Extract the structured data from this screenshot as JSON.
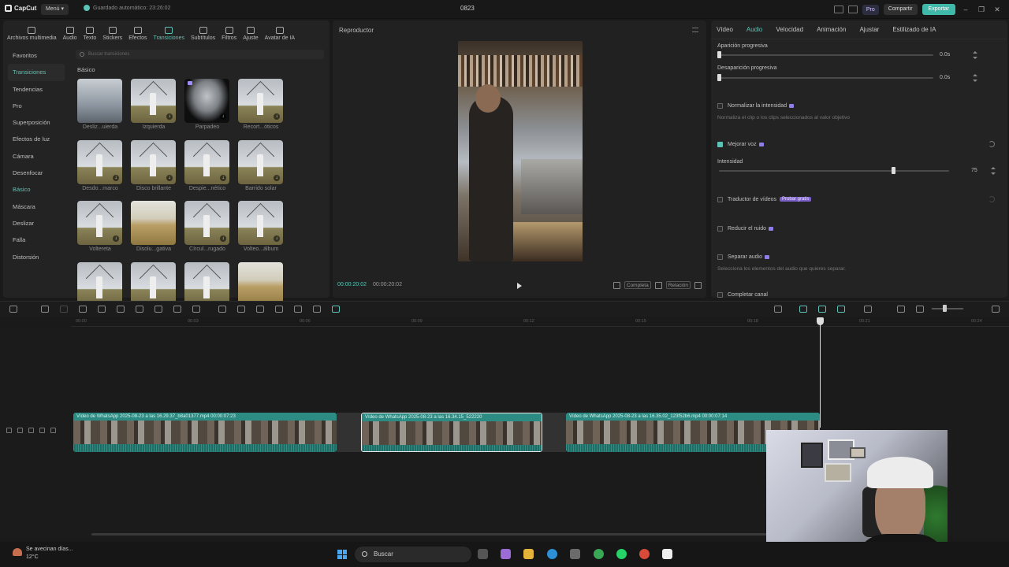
{
  "titlebar": {
    "app_name": "CapCut",
    "menu_label": "Menú",
    "autosave": "Guardado automático: 23:26:02",
    "project_name": "0823",
    "pro_label": "Pro",
    "share_label": "Compartir",
    "export_label": "Exportar"
  },
  "tools": [
    {
      "label": "Archivos multimedia",
      "icon": "media-icon"
    },
    {
      "label": "Audio",
      "icon": "audio-icon"
    },
    {
      "label": "Texto",
      "icon": "text-icon"
    },
    {
      "label": "Stickers",
      "icon": "sticker-icon"
    },
    {
      "label": "Efectos",
      "icon": "effects-icon"
    },
    {
      "label": "Transiciones",
      "icon": "transitions-icon",
      "active": true
    },
    {
      "label": "Subtítulos",
      "icon": "subtitles-icon"
    },
    {
      "label": "Filtros",
      "icon": "filters-icon"
    },
    {
      "label": "Ajuste",
      "icon": "adjust-icon"
    },
    {
      "label": "Avatar de IA",
      "icon": "ai-avatar-icon"
    }
  ],
  "categories": [
    "Favoritos",
    "Transiciones",
    "Tendencias",
    "Pro",
    "Superposición",
    "Efectos de luz",
    "Cámara",
    "Desenfocar",
    "Básico",
    "Máscara",
    "Deslizar",
    "Falla",
    "Distorsión"
  ],
  "search_placeholder": "Buscar transiciones",
  "section_label": "Básico",
  "transitions": [
    {
      "label": "Desliz...uierda",
      "thumb": "city",
      "download": false,
      "badge": false
    },
    {
      "label": "Izquierda",
      "thumb": "mill",
      "download": true,
      "badge": false
    },
    {
      "label": "Parpadeo",
      "thumb": "dark",
      "download": true,
      "badge": true
    },
    {
      "label": "Recort...óticos",
      "thumb": "mill",
      "download": true,
      "badge": false
    },
    {
      "label": "Desdo...marco",
      "thumb": "mill",
      "download": true,
      "badge": false
    },
    {
      "label": "Disco brillante",
      "thumb": "mill",
      "download": true,
      "badge": false
    },
    {
      "label": "Despie...nético",
      "thumb": "mill",
      "download": true,
      "badge": false
    },
    {
      "label": "Barrido solar",
      "thumb": "mill",
      "download": true,
      "badge": false
    },
    {
      "label": "Voltereta",
      "thumb": "mill",
      "download": true,
      "badge": false
    },
    {
      "label": "Disolu...gativa",
      "thumb": "field",
      "download": false,
      "badge": false
    },
    {
      "label": "Círcul...rugado",
      "thumb": "mill",
      "download": true,
      "badge": false
    },
    {
      "label": "Volteo...álbum",
      "thumb": "mill",
      "download": true,
      "badge": false
    },
    {
      "label": "",
      "thumb": "mill",
      "download": false,
      "badge": false
    },
    {
      "label": "",
      "thumb": "mill",
      "download": false,
      "badge": false
    },
    {
      "label": "",
      "thumb": "mill",
      "download": false,
      "badge": false
    },
    {
      "label": "",
      "thumb": "field",
      "download": false,
      "badge": false
    }
  ],
  "player": {
    "title": "Reproductor",
    "current_time": "00:00:20:02",
    "total_time": "00:00:20:02",
    "full_label": "Completa",
    "ratio_label": "Relación"
  },
  "inspector": {
    "tabs": [
      "Vídeo",
      "Audio",
      "Velocidad",
      "Animación",
      "Ajustar",
      "Estilizado de IA"
    ],
    "active_tab": 1,
    "fade_in_label": "Aparición progresiva",
    "fade_in_value": "0.0s",
    "fade_out_label": "Desaparición progresiva",
    "fade_out_value": "0.0s",
    "normalize_label": "Normalizar la intensidad",
    "normalize_note": "Normaliza el clip o los clips seleccionados al valor objetivo",
    "enhance_voice_label": "Mejorar voz",
    "intensity_label": "Intensidad",
    "intensity_value": "75",
    "translator_label": "Traductor de vídeos",
    "translator_chip": "Probar gratis",
    "reduce_noise_label": "Reducir el ruido",
    "separate_audio_label": "Separar audio",
    "separate_note": "Selecciona los elementos del audio que quieres separar.",
    "complete_channel_label": "Completar canal"
  },
  "ruler_ticks": [
    "00:00",
    "00:03",
    "00:06",
    "00:09",
    "00:12",
    "00:15",
    "00:18",
    "00:21",
    "00:24"
  ],
  "clips": [
    {
      "label": "Vídeo de WhatsApp 2025-08-23 a las 16.29.37_b8a01377.mp4   00:00:07:23"
    },
    {
      "label": "Vídeo de WhatsApp 2025-08-23 a las 16.34.15_522220"
    },
    {
      "label": "Vídeo de WhatsApp 2025-08-23 a las 16.35.02_123f52b6.mp4   00:00:07:14"
    }
  ],
  "taskbar": {
    "weather_title": "Se avecinan días...",
    "weather_temp": "12°C",
    "search_label": "Buscar"
  },
  "colors": {
    "accent": "#5cc3b6",
    "clip": "#2c8b82",
    "background": "#1a1a1a"
  }
}
